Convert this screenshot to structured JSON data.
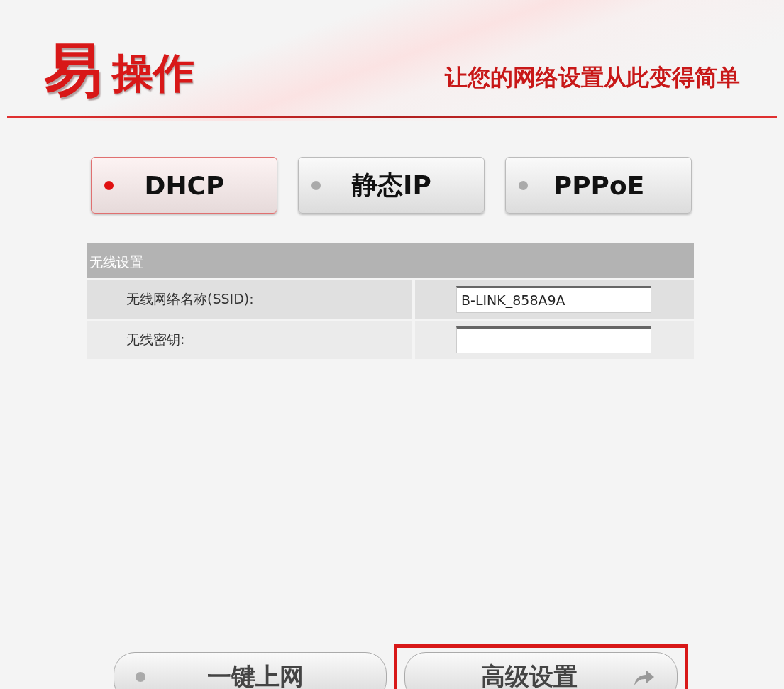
{
  "header": {
    "logo_big": "易",
    "logo_rest": "操作",
    "tagline": "让您的网络设置从此变得简单"
  },
  "modes": [
    {
      "label": "DHCP",
      "selected": true
    },
    {
      "label": "静态IP",
      "selected": false
    },
    {
      "label": "PPPoE",
      "selected": false
    }
  ],
  "wireless": {
    "title": "无线设置",
    "fields": [
      {
        "label": "无线网络名称(SSID):",
        "value": "B-LINK_858A9A"
      },
      {
        "label": "无线密钥:"
      }
    ]
  },
  "actions": [
    {
      "label": "一键上网",
      "kind": "dot",
      "highlighted": false
    },
    {
      "label": "高级设置",
      "kind": "arrow",
      "highlighted": true
    }
  ]
}
